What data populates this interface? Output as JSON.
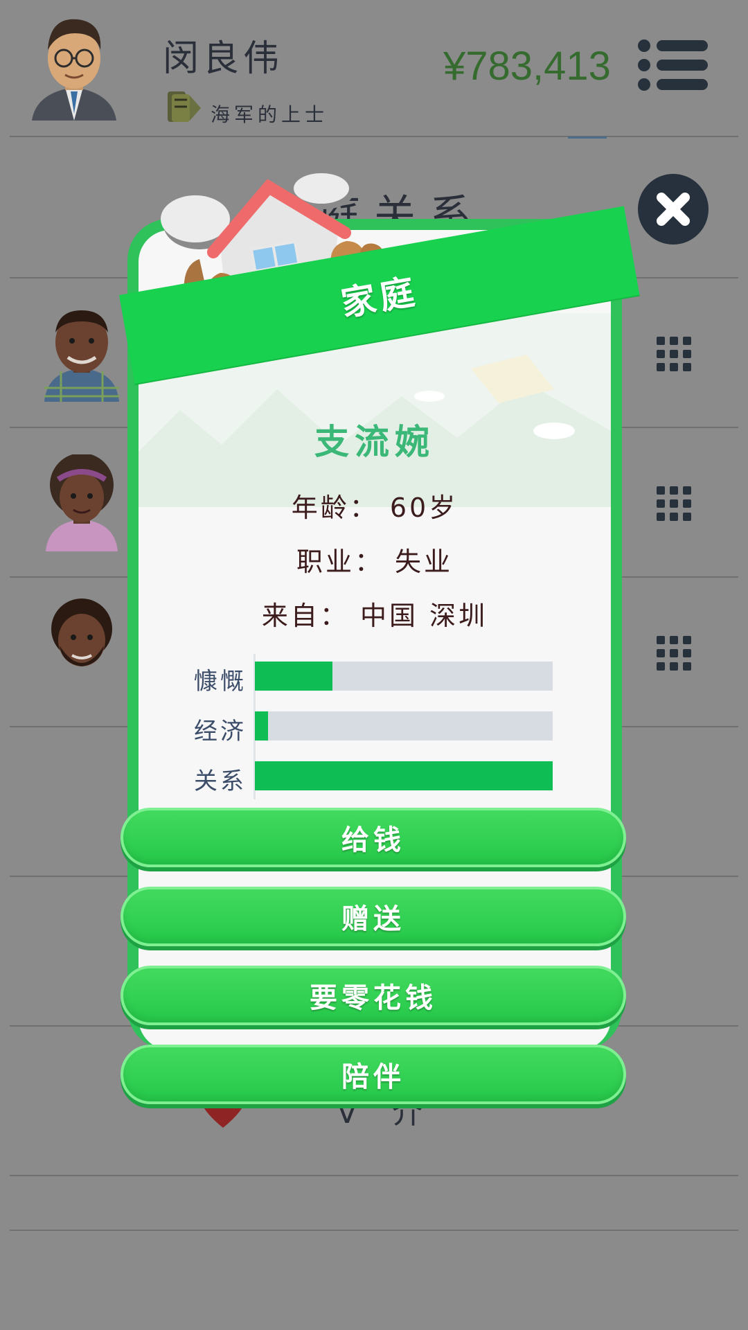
{
  "player": {
    "name": "闵良伟",
    "rank": "海军的上士",
    "money": "¥783,413"
  },
  "page": {
    "title": "家庭关系",
    "background_text": "Ⅴ 介"
  },
  "modal": {
    "ribbon": "家庭",
    "member_name": "支流婉",
    "info": {
      "age": "年龄： 60岁",
      "job": "职业： 失业",
      "origin": "来自： 中国 深圳"
    },
    "stats": [
      {
        "label": "慷慨",
        "value": 0.26
      },
      {
        "label": "经济",
        "value": 0.045
      },
      {
        "label": "关系",
        "value": 1.0
      }
    ],
    "actions": {
      "give_money": "给钱",
      "gift": "赠送",
      "ask_allowance": "要零花钱",
      "accompany": "陪伴"
    }
  },
  "colors": {
    "accent_green": "#18d14e",
    "bar_fill": "#0fbd55",
    "money": "#356b2f",
    "name": "#3bb877"
  }
}
